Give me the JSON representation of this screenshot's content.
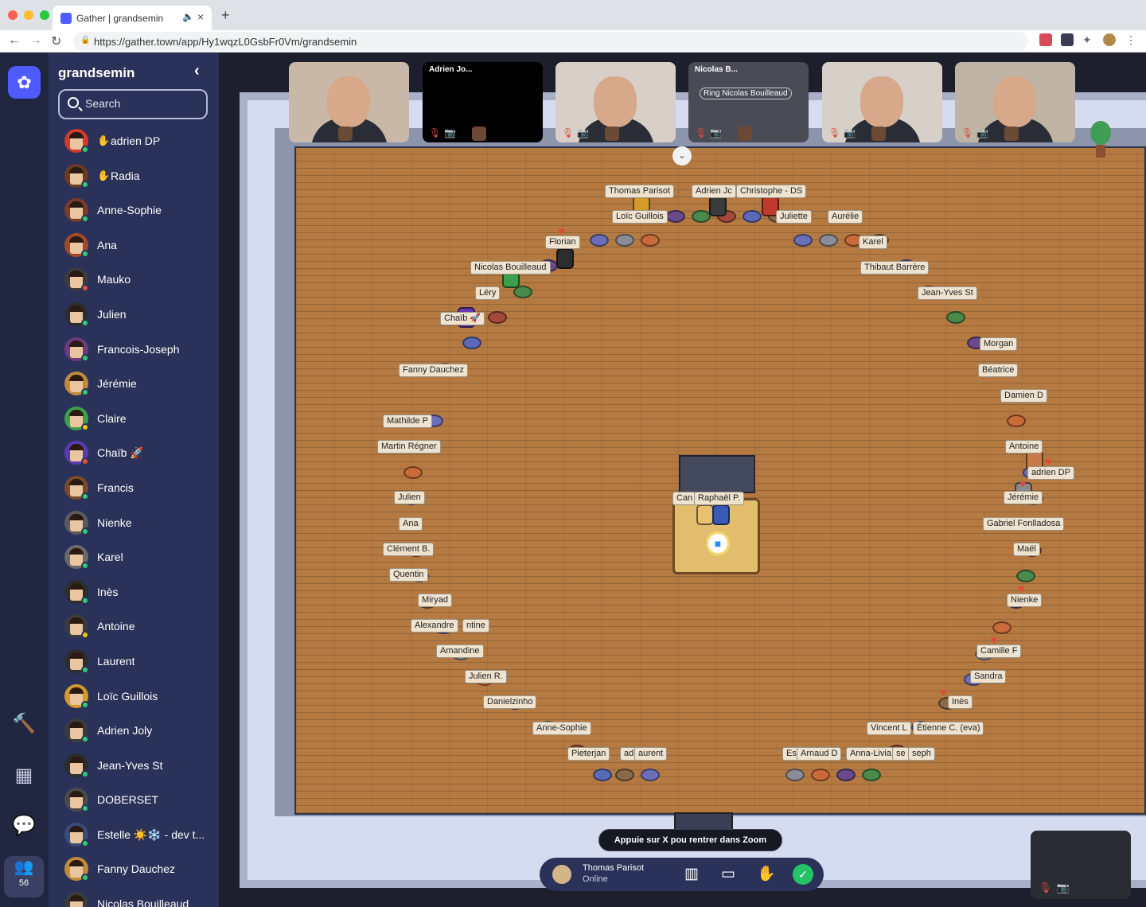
{
  "browser": {
    "tab_title": "Gather | grandsemin",
    "url": "https://gather.town/app/Hy1wqzL0GsbFr0Vm/grandsemin"
  },
  "sidebar": {
    "space_name": "grandsemin",
    "search_placeholder": "Search",
    "participant_count": "56",
    "people": [
      {
        "name": "adrien DP",
        "hand": true,
        "status": "#2ecc71",
        "skin": "#d23a2a"
      },
      {
        "name": "Radia",
        "hand": true,
        "status": "#2ecc71",
        "skin": "#6b3a22"
      },
      {
        "name": "Anne-Sophie",
        "hand": false,
        "status": "#2ecc71",
        "skin": "#7a3b2a"
      },
      {
        "name": "Ana",
        "hand": false,
        "status": "#2ecc71",
        "skin": "#a04a2a"
      },
      {
        "name": "Mauko",
        "hand": false,
        "status": "#e74c3c",
        "skin": "#3b3b3b"
      },
      {
        "name": "Julien",
        "hand": false,
        "status": "#2ecc71",
        "skin": "#2d2d2d"
      },
      {
        "name": "Francois-Joseph",
        "hand": false,
        "status": "#2ecc71",
        "skin": "#6d3a7a"
      },
      {
        "name": "Jérémie",
        "hand": false,
        "status": "#2ecc71",
        "skin": "#c08a3a"
      },
      {
        "name": "Claire",
        "hand": false,
        "status": "#f1c40f",
        "skin": "#3aa04a"
      },
      {
        "name": "Chaïb 🚀",
        "hand": false,
        "status": "#e74c3c",
        "skin": "#5a3ab0"
      },
      {
        "name": "Francis",
        "hand": false,
        "status": "#2ecc71",
        "skin": "#7a4a2a"
      },
      {
        "name": "Nienke",
        "hand": false,
        "status": "#2ecc71",
        "skin": "#5a5a5a"
      },
      {
        "name": "Karel",
        "hand": false,
        "status": "#2ecc71",
        "skin": "#6a6a6a"
      },
      {
        "name": "Inès",
        "hand": false,
        "status": "#2ecc71",
        "skin": "#2d2d2d"
      },
      {
        "name": "Antoine",
        "hand": false,
        "status": "#f1c40f",
        "skin": "#3b3b3b"
      },
      {
        "name": "Laurent",
        "hand": false,
        "status": "#2ecc71",
        "skin": "#2d2d2d"
      },
      {
        "name": "Loïc Guillois",
        "hand": false,
        "status": "#2ecc71",
        "skin": "#d49a2a"
      },
      {
        "name": "Adrien Joly",
        "hand": false,
        "status": "#2ecc71",
        "skin": "#3b3b3b"
      },
      {
        "name": "Jean-Yves St",
        "hand": false,
        "status": "#2ecc71",
        "skin": "#2d2d2d"
      },
      {
        "name": "DOBERSET",
        "hand": false,
        "status": "#2ecc71",
        "skin": "#4a4a4a"
      },
      {
        "name": "Estelle ☀️❄️ - dev t...",
        "hand": false,
        "status": "#2ecc71",
        "skin": "#3a4a7a"
      },
      {
        "name": "Fanny Dauchez",
        "hand": false,
        "status": "#2ecc71",
        "skin": "#c08a3a"
      },
      {
        "name": "Nicolas Bouilleaud",
        "hand": false,
        "status": "#2ecc71",
        "skin": "#3b3b3b"
      }
    ]
  },
  "videos": [
    {
      "name": "",
      "ring": "",
      "muted": false,
      "kind": "camera",
      "bg": "#c9b8a8"
    },
    {
      "name": "Adrien Jo...",
      "ring": "",
      "muted": true,
      "kind": "off",
      "bg": "#000000"
    },
    {
      "name": "",
      "ring": "",
      "muted": true,
      "kind": "camera",
      "bg": "#d8d0c8"
    },
    {
      "name": "Nicolas B...",
      "ring": "Ring Nicolas Bouilleaud",
      "muted": true,
      "kind": "off",
      "bg": "#4a4c55"
    },
    {
      "name": "",
      "ring": "",
      "muted": true,
      "kind": "camera",
      "bg": "#d6d0c8"
    },
    {
      "name": "",
      "ring": "",
      "muted": true,
      "kind": "camera",
      "bg": "#bfb3a3"
    }
  ],
  "map_labels": [
    {
      "t": "Thomas Parisot"
    },
    {
      "t": "Adrien Jc"
    },
    {
      "t": "Christophe - DS"
    },
    {
      "t": "Loïc Guillois"
    },
    {
      "t": "Juliette"
    },
    {
      "t": "Aurélie"
    },
    {
      "t": "Florian"
    },
    {
      "t": "Karel"
    },
    {
      "t": "Nicolas Bouilleaud"
    },
    {
      "t": "Thibaut Barrère"
    },
    {
      "t": "Léry"
    },
    {
      "t": "Jean-Yves St"
    },
    {
      "t": "Chaïb 🚀"
    },
    {
      "t": "Morgan"
    },
    {
      "t": "Fanny Dauchez"
    },
    {
      "t": "Béatrice"
    },
    {
      "t": "Damien D"
    },
    {
      "t": "Mathilde P"
    },
    {
      "t": "Martin Régner"
    },
    {
      "t": "Antoine"
    },
    {
      "t": "adrien DP"
    },
    {
      "t": "Julien"
    },
    {
      "t": "Jérémie"
    },
    {
      "t": "Ana"
    },
    {
      "t": "Gabriel Fonlladosa"
    },
    {
      "t": "Clément B."
    },
    {
      "t": "Maël"
    },
    {
      "t": "Quentin"
    },
    {
      "t": "Miryad"
    },
    {
      "t": "Nienke"
    },
    {
      "t": "Alexandre"
    },
    {
      "t": "ntine"
    },
    {
      "t": "Amandine"
    },
    {
      "t": "Camille F"
    },
    {
      "t": "Julien R."
    },
    {
      "t": "Sandra"
    },
    {
      "t": "Danielzinho"
    },
    {
      "t": "Inès"
    },
    {
      "t": "Anne-Sophie"
    },
    {
      "t": "Vincent L"
    },
    {
      "t": "Étienne C. (eva)"
    },
    {
      "t": "Pieterjan"
    },
    {
      "t": "adia"
    },
    {
      "t": "aurent"
    },
    {
      "t": "Est"
    },
    {
      "t": "Arnaud D"
    },
    {
      "t": "Anna-Livia"
    },
    {
      "t": "se"
    },
    {
      "t": "seph"
    },
    {
      "t": "Can"
    },
    {
      "t": "Raphaël P."
    }
  ],
  "toast": "Appuie sur X pou rentrer dans Zoom",
  "me": {
    "name": "Thomas Parisot",
    "status": "Online"
  }
}
